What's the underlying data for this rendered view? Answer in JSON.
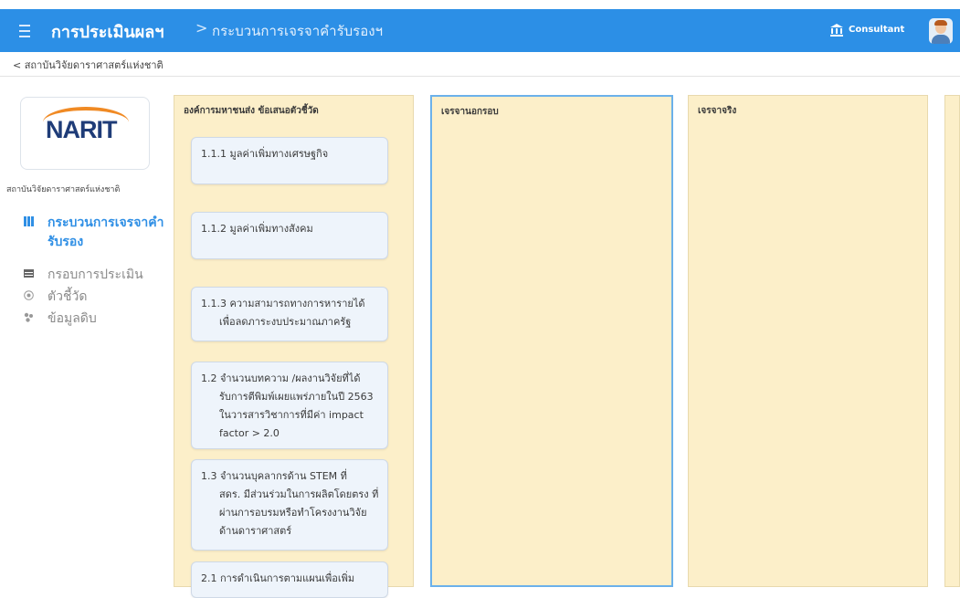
{
  "header": {
    "app_title": "การประเมินผลฯ",
    "separator": ">",
    "page_title": "กระบวนการเจรจาคำรับรองฯ",
    "user_label": "Consultant"
  },
  "breadcrumb": "< สถาบันวิจัยดาราศาสตร์แห่งชาติ",
  "sidebar": {
    "logo_text": "NARIT",
    "org_name": "สถาบันวิจัยดาราศาสตร์แห่งชาติ",
    "items": [
      {
        "label": "กระบวนการเจรจาคำรับรอง",
        "icon": "columns-icon",
        "active": true
      },
      {
        "label": "กรอบการประเมิน",
        "icon": "table-icon",
        "active": false
      },
      {
        "label": "ตัวชี้วัด",
        "icon": "target-icon",
        "active": false
      },
      {
        "label": "ข้อมูลดิบ",
        "icon": "database-icon",
        "active": false
      }
    ]
  },
  "columns": [
    {
      "title": "องค์การมหาชนส่ง ข้อเสนอตัวชี้วัด"
    },
    {
      "title": "เจรจานอกรอบ"
    },
    {
      "title": "เจรจาจริง"
    }
  ],
  "cards": [
    {
      "line1": "1.1.1  มูลค่าเพิ่มทางเศรษฐกิจ",
      "rest": ""
    },
    {
      "line1": "1.1.2  มูลค่าเพิ่มทางสังคม",
      "rest": ""
    },
    {
      "line1": "1.1.3 ความสามารถทางการหารายได้",
      "rest": "เพื่อลดภาระงบประมาณภาครัฐ"
    },
    {
      "line1": "1.2 จำนวนบทความ /ผลงานวิจัยที่ได้",
      "rest": "รับการตีพิมพ์เผยแพร่ภายในปี 2563 ในวารสารวิชาการที่มีค่า impact factor > 2.0"
    },
    {
      "line1": "1.3 จำนวนบุคลากรด้าน STEM ที่",
      "rest": "สดร. มีส่วนร่วมในการผลิตโดยตรง ที่ผ่านการอบรมหรือทำโครงงานวิจัยด้านดาราศาสตร์"
    },
    {
      "line1": "2.1 การดำเนินการตามแผนเพื่อเพิ่ม",
      "rest": ""
    }
  ],
  "colors": {
    "header_bg": "#2c8fe6",
    "column_bg": "#fcefc9",
    "card_bg": "#eef4fb",
    "active_nav": "#2f8fe5"
  }
}
